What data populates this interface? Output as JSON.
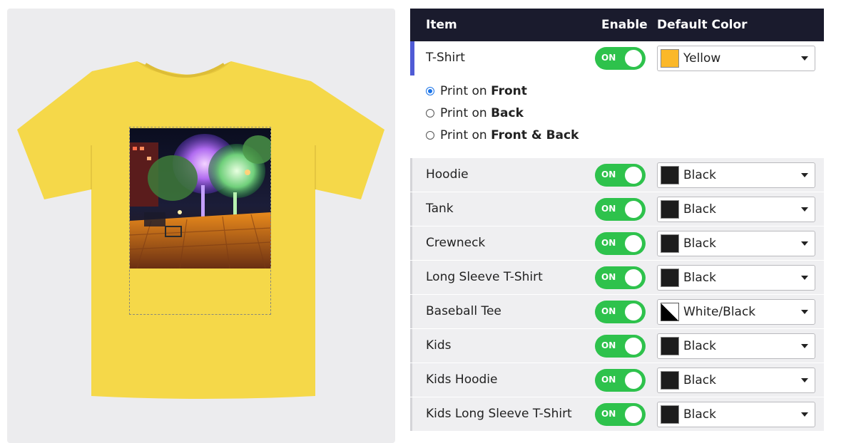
{
  "preview": {
    "shirt_color": "#f5d849",
    "artwork_icon": "night-park-trees-photo"
  },
  "table": {
    "headers": {
      "item": "Item",
      "enable": "Enable",
      "default_color": "Default Color"
    },
    "toggle_on_label": "ON",
    "accent_color": "#4f5bd5",
    "toggle_color": "#2ec24c",
    "rows": [
      {
        "name": "T-Shirt",
        "enabled": true,
        "color_label": "Yellow",
        "swatch": "#fbb829"
      },
      {
        "name": "Hoodie",
        "enabled": true,
        "color_label": "Black",
        "swatch": "#1c1c1c"
      },
      {
        "name": "Tank",
        "enabled": true,
        "color_label": "Black",
        "swatch": "#1c1c1c"
      },
      {
        "name": "Crewneck",
        "enabled": true,
        "color_label": "Black",
        "swatch": "#1c1c1c"
      },
      {
        "name": "Long Sleeve T-Shirt",
        "enabled": true,
        "color_label": "Black",
        "swatch": "#1c1c1c"
      },
      {
        "name": "Baseball Tee",
        "enabled": true,
        "color_label": "White/Black",
        "swatch": "white-black-split"
      },
      {
        "name": "Kids",
        "enabled": true,
        "color_label": "Black",
        "swatch": "#1c1c1c"
      },
      {
        "name": "Kids Hoodie",
        "enabled": true,
        "color_label": "Black",
        "swatch": "#1c1c1c"
      },
      {
        "name": "Kids Long Sleeve T-Shirt",
        "enabled": true,
        "color_label": "Black",
        "swatch": "#1c1c1c"
      }
    ],
    "print_options": {
      "prefix": "Print on ",
      "options": [
        {
          "bold": "Front",
          "checked": true
        },
        {
          "bold": "Back",
          "checked": false
        },
        {
          "bold": "Front & Back",
          "checked": false
        }
      ]
    }
  }
}
